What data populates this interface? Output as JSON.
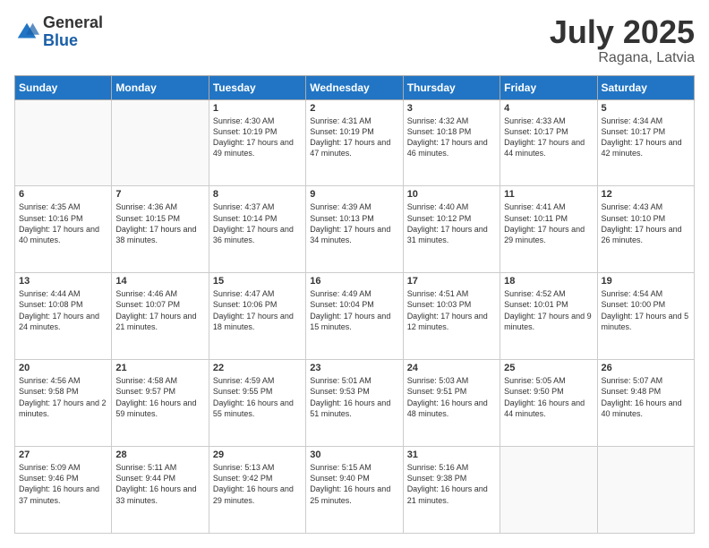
{
  "logo": {
    "general": "General",
    "blue": "Blue"
  },
  "header": {
    "month": "July 2025",
    "location": "Ragana, Latvia"
  },
  "weekdays": [
    "Sunday",
    "Monday",
    "Tuesday",
    "Wednesday",
    "Thursday",
    "Friday",
    "Saturday"
  ],
  "weeks": [
    [
      {
        "day": null
      },
      {
        "day": null
      },
      {
        "day": "1",
        "sunrise": "Sunrise: 4:30 AM",
        "sunset": "Sunset: 10:19 PM",
        "daylight": "Daylight: 17 hours and 49 minutes."
      },
      {
        "day": "2",
        "sunrise": "Sunrise: 4:31 AM",
        "sunset": "Sunset: 10:19 PM",
        "daylight": "Daylight: 17 hours and 47 minutes."
      },
      {
        "day": "3",
        "sunrise": "Sunrise: 4:32 AM",
        "sunset": "Sunset: 10:18 PM",
        "daylight": "Daylight: 17 hours and 46 minutes."
      },
      {
        "day": "4",
        "sunrise": "Sunrise: 4:33 AM",
        "sunset": "Sunset: 10:17 PM",
        "daylight": "Daylight: 17 hours and 44 minutes."
      },
      {
        "day": "5",
        "sunrise": "Sunrise: 4:34 AM",
        "sunset": "Sunset: 10:17 PM",
        "daylight": "Daylight: 17 hours and 42 minutes."
      }
    ],
    [
      {
        "day": "6",
        "sunrise": "Sunrise: 4:35 AM",
        "sunset": "Sunset: 10:16 PM",
        "daylight": "Daylight: 17 hours and 40 minutes."
      },
      {
        "day": "7",
        "sunrise": "Sunrise: 4:36 AM",
        "sunset": "Sunset: 10:15 PM",
        "daylight": "Daylight: 17 hours and 38 minutes."
      },
      {
        "day": "8",
        "sunrise": "Sunrise: 4:37 AM",
        "sunset": "Sunset: 10:14 PM",
        "daylight": "Daylight: 17 hours and 36 minutes."
      },
      {
        "day": "9",
        "sunrise": "Sunrise: 4:39 AM",
        "sunset": "Sunset: 10:13 PM",
        "daylight": "Daylight: 17 hours and 34 minutes."
      },
      {
        "day": "10",
        "sunrise": "Sunrise: 4:40 AM",
        "sunset": "Sunset: 10:12 PM",
        "daylight": "Daylight: 17 hours and 31 minutes."
      },
      {
        "day": "11",
        "sunrise": "Sunrise: 4:41 AM",
        "sunset": "Sunset: 10:11 PM",
        "daylight": "Daylight: 17 hours and 29 minutes."
      },
      {
        "day": "12",
        "sunrise": "Sunrise: 4:43 AM",
        "sunset": "Sunset: 10:10 PM",
        "daylight": "Daylight: 17 hours and 26 minutes."
      }
    ],
    [
      {
        "day": "13",
        "sunrise": "Sunrise: 4:44 AM",
        "sunset": "Sunset: 10:08 PM",
        "daylight": "Daylight: 17 hours and 24 minutes."
      },
      {
        "day": "14",
        "sunrise": "Sunrise: 4:46 AM",
        "sunset": "Sunset: 10:07 PM",
        "daylight": "Daylight: 17 hours and 21 minutes."
      },
      {
        "day": "15",
        "sunrise": "Sunrise: 4:47 AM",
        "sunset": "Sunset: 10:06 PM",
        "daylight": "Daylight: 17 hours and 18 minutes."
      },
      {
        "day": "16",
        "sunrise": "Sunrise: 4:49 AM",
        "sunset": "Sunset: 10:04 PM",
        "daylight": "Daylight: 17 hours and 15 minutes."
      },
      {
        "day": "17",
        "sunrise": "Sunrise: 4:51 AM",
        "sunset": "Sunset: 10:03 PM",
        "daylight": "Daylight: 17 hours and 12 minutes."
      },
      {
        "day": "18",
        "sunrise": "Sunrise: 4:52 AM",
        "sunset": "Sunset: 10:01 PM",
        "daylight": "Daylight: 17 hours and 9 minutes."
      },
      {
        "day": "19",
        "sunrise": "Sunrise: 4:54 AM",
        "sunset": "Sunset: 10:00 PM",
        "daylight": "Daylight: 17 hours and 5 minutes."
      }
    ],
    [
      {
        "day": "20",
        "sunrise": "Sunrise: 4:56 AM",
        "sunset": "Sunset: 9:58 PM",
        "daylight": "Daylight: 17 hours and 2 minutes."
      },
      {
        "day": "21",
        "sunrise": "Sunrise: 4:58 AM",
        "sunset": "Sunset: 9:57 PM",
        "daylight": "Daylight: 16 hours and 59 minutes."
      },
      {
        "day": "22",
        "sunrise": "Sunrise: 4:59 AM",
        "sunset": "Sunset: 9:55 PM",
        "daylight": "Daylight: 16 hours and 55 minutes."
      },
      {
        "day": "23",
        "sunrise": "Sunrise: 5:01 AM",
        "sunset": "Sunset: 9:53 PM",
        "daylight": "Daylight: 16 hours and 51 minutes."
      },
      {
        "day": "24",
        "sunrise": "Sunrise: 5:03 AM",
        "sunset": "Sunset: 9:51 PM",
        "daylight": "Daylight: 16 hours and 48 minutes."
      },
      {
        "day": "25",
        "sunrise": "Sunrise: 5:05 AM",
        "sunset": "Sunset: 9:50 PM",
        "daylight": "Daylight: 16 hours and 44 minutes."
      },
      {
        "day": "26",
        "sunrise": "Sunrise: 5:07 AM",
        "sunset": "Sunset: 9:48 PM",
        "daylight": "Daylight: 16 hours and 40 minutes."
      }
    ],
    [
      {
        "day": "27",
        "sunrise": "Sunrise: 5:09 AM",
        "sunset": "Sunset: 9:46 PM",
        "daylight": "Daylight: 16 hours and 37 minutes."
      },
      {
        "day": "28",
        "sunrise": "Sunrise: 5:11 AM",
        "sunset": "Sunset: 9:44 PM",
        "daylight": "Daylight: 16 hours and 33 minutes."
      },
      {
        "day": "29",
        "sunrise": "Sunrise: 5:13 AM",
        "sunset": "Sunset: 9:42 PM",
        "daylight": "Daylight: 16 hours and 29 minutes."
      },
      {
        "day": "30",
        "sunrise": "Sunrise: 5:15 AM",
        "sunset": "Sunset: 9:40 PM",
        "daylight": "Daylight: 16 hours and 25 minutes."
      },
      {
        "day": "31",
        "sunrise": "Sunrise: 5:16 AM",
        "sunset": "Sunset: 9:38 PM",
        "daylight": "Daylight: 16 hours and 21 minutes."
      },
      {
        "day": null
      },
      {
        "day": null
      }
    ]
  ]
}
